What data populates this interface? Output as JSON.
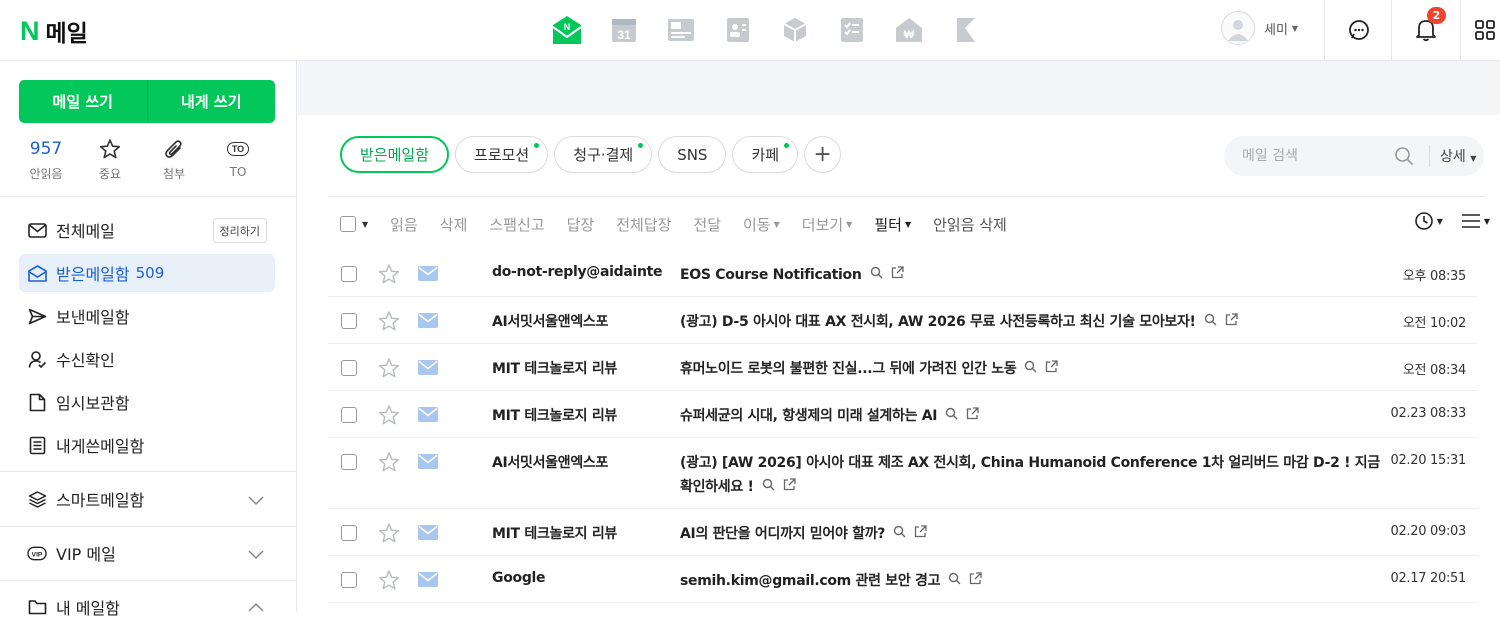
{
  "header": {
    "logo_n": "N",
    "logo_text": "메일",
    "apps": [
      "mail-app-icon",
      "calendar-app-icon",
      "contacts-app-icon",
      "profile-card-app-icon",
      "box-app-icon",
      "todo-app-icon",
      "pay-app-icon",
      "flag-app-icon"
    ],
    "calendar_day": "31",
    "user_name": "세미",
    "notification_count": "2",
    "brand_color": "#03c75a"
  },
  "sidebar": {
    "compose_label": "메일 쓰기",
    "self_compose_label": "내게 쓰기",
    "quick": {
      "unread_count": "957",
      "unread_label": "안읽음",
      "important_label": "중요",
      "attach_label": "첨부",
      "to_badge": "TO",
      "to_label": "TO"
    },
    "folders": [
      {
        "label": "전체메일",
        "icon": "mail-icon",
        "action": "정리하기"
      },
      {
        "label": "받은메일함",
        "icon": "inbox-icon",
        "count": "509"
      },
      {
        "label": "보낸메일함",
        "icon": "send-icon"
      },
      {
        "label": "수신확인",
        "icon": "read-receipt-icon"
      },
      {
        "label": "임시보관함",
        "icon": "draft-icon"
      },
      {
        "label": "내게쓴메일함",
        "icon": "memo-icon"
      }
    ],
    "groups": [
      {
        "label": "스마트메일함",
        "icon": "layers-icon"
      },
      {
        "label": "VIP 메일",
        "icon": "vip-icon"
      },
      {
        "label": "내 메일함",
        "icon": "folder-icon"
      }
    ]
  },
  "main": {
    "tabs": [
      {
        "label": "받은메일함",
        "dot": false
      },
      {
        "label": "프로모션",
        "dot": true
      },
      {
        "label": "청구·결제",
        "dot": true
      },
      {
        "label": "SNS",
        "dot": false
      },
      {
        "label": "카페",
        "dot": true
      }
    ],
    "tab_add": "+",
    "search": {
      "placeholder": "메일 검색",
      "detail_label": "상세"
    },
    "toolbar": {
      "read": "읽음",
      "delete": "삭제",
      "spam": "스팸신고",
      "reply": "답장",
      "reply_all": "전체답장",
      "forward": "전달",
      "move": "이동",
      "more": "더보기",
      "filter": "필터",
      "delete_unread": "안읽음 삭제"
    },
    "emails": [
      {
        "sender": "do-not-reply@aidainter...",
        "subject": "EOS Course Notification",
        "date": "오후 08:35"
      },
      {
        "sender": "AI서밋서울앤엑스포",
        "subject": "(광고) D-5 아시아 대표 AX 전시회, AW 2026 무료 사전등록하고 최신 기술 모아보자!",
        "date": "오전 10:02"
      },
      {
        "sender": "MIT 테크놀로지 리뷰",
        "subject": "휴머노이드 로봇의 불편한 진실...그 뒤에 가려진 인간 노동",
        "date": "오전 08:34"
      },
      {
        "sender": "MIT 테크놀로지 리뷰",
        "subject": "슈퍼세균의 시대, 항생제의 미래 설계하는 AI",
        "date": "02.23 08:33"
      },
      {
        "sender": "AI서밋서울앤엑스포",
        "subject": "(광고) [AW 2026] 아시아 대표 제조 AX 전시회, China Humanoid Conference 1차 얼리버드 마감 D-2 ! 지금 확인하세요 !",
        "date": "02.20 15:31"
      },
      {
        "sender": "MIT 테크놀로지 리뷰",
        "subject": "AI의 판단을 어디까지 믿어야 할까?",
        "date": "02.20 09:03"
      },
      {
        "sender": "Google",
        "subject": "semih.kim@gmail.com 관련 보안 경고",
        "date": "02.17 20:51"
      }
    ]
  }
}
